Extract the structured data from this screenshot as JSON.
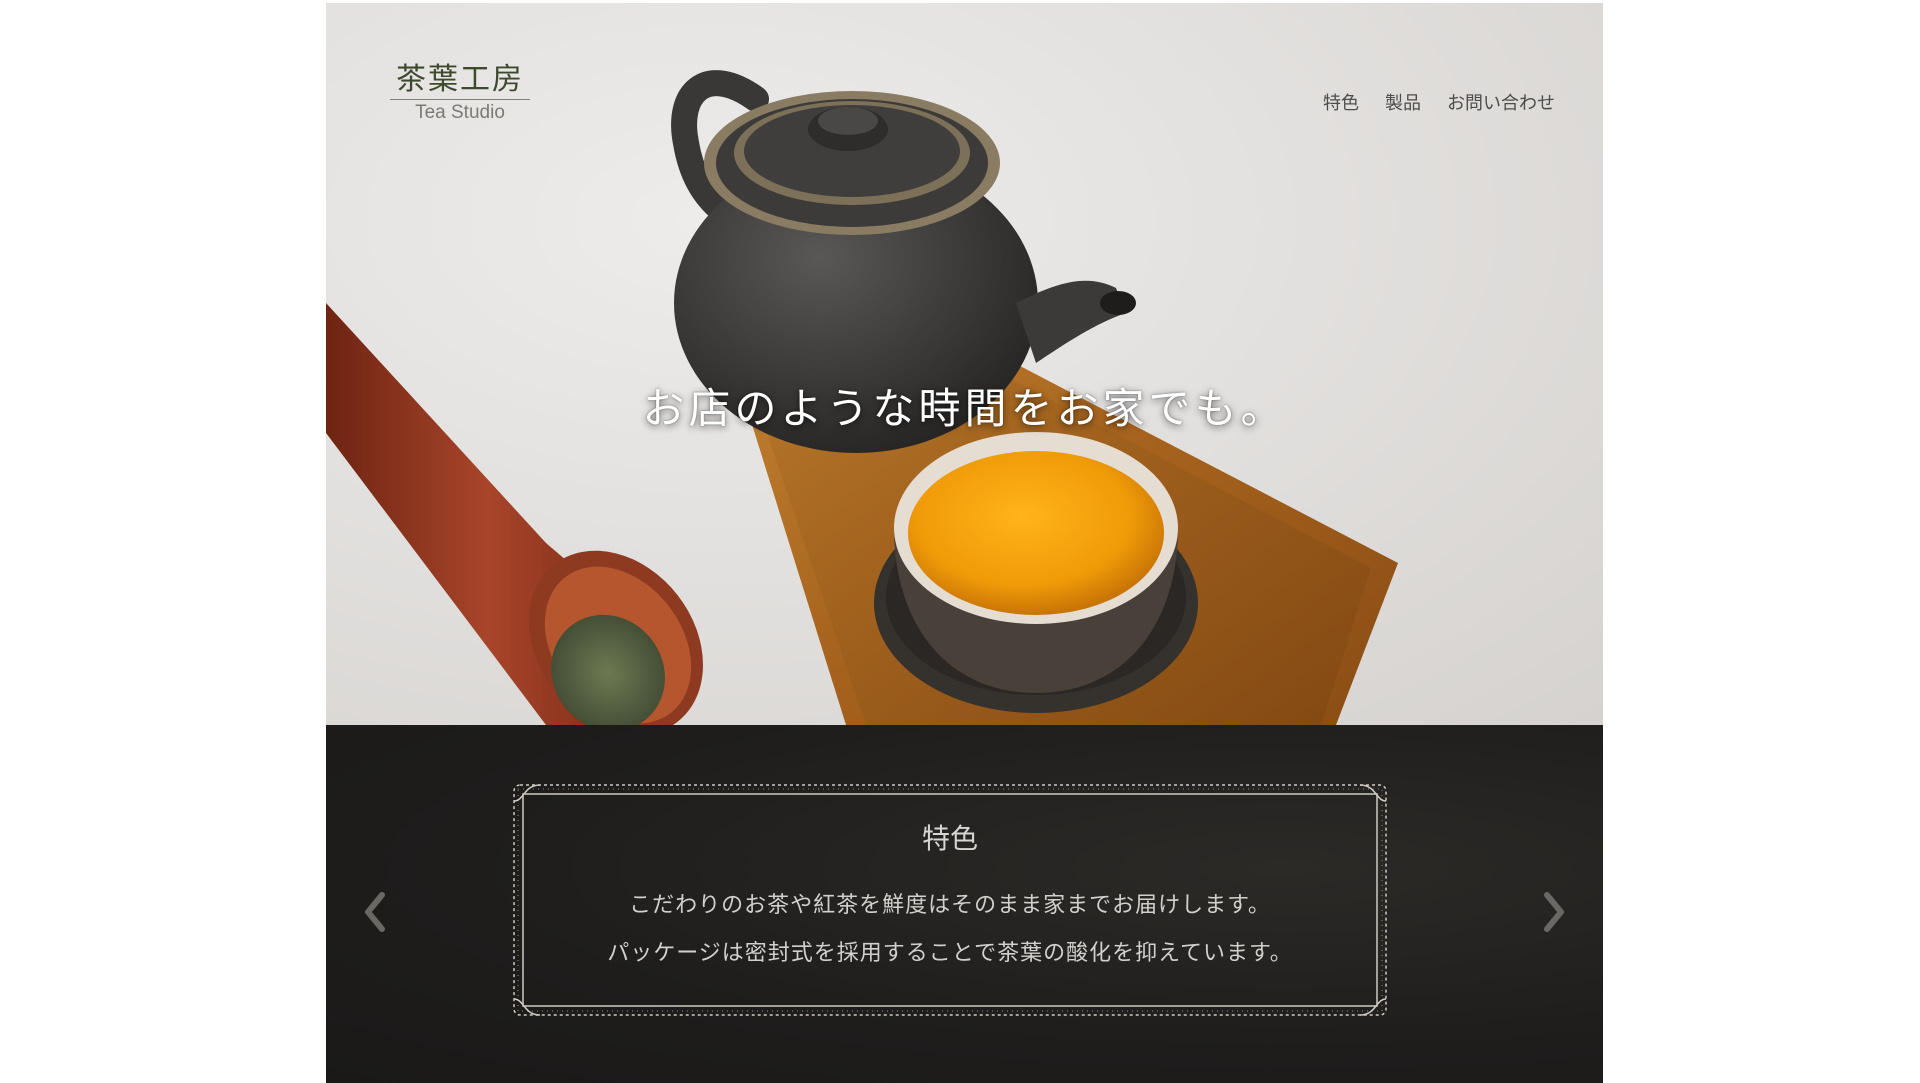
{
  "brand": {
    "name_ja": "茶葉工房",
    "name_en": "Tea Studio"
  },
  "nav": {
    "items": [
      {
        "label": "特色"
      },
      {
        "label": "製品"
      },
      {
        "label": "お問い合わせ"
      }
    ]
  },
  "hero": {
    "title": "お店のような時間をお家でも。"
  },
  "feature": {
    "heading": "特色",
    "line1": "こだわりのお茶や紅茶を鮮度はそのまま家までお届けします。",
    "line2": "パッケージは密封式を採用することで茶葉の酸化を抑えています。"
  },
  "icons": {
    "prev": "chevron-left-icon",
    "next": "chevron-right-icon"
  },
  "colors": {
    "logo_kanji": "#3e4a2e",
    "feature_bg": "#1f1e1d",
    "frame_ornament": "#cfcac2"
  }
}
